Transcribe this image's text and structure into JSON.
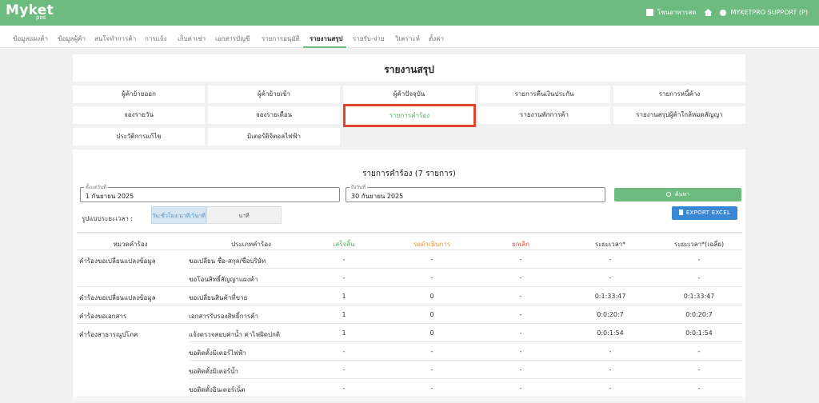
{
  "app": {
    "logo": "Myket",
    "logo_sub": "pos",
    "store_label": "โชนอาหารสด",
    "user_label": "MYKETPRO SUPPORT (P)"
  },
  "nav": {
    "tabs": [
      "ข้อมูลแผงค้า",
      "ข้อมูลผู้ค้า",
      "สนใจทำการค้า",
      "การแจ้ง",
      "เก็บค่าเช่า",
      "เอกสารบัญชี",
      "รายการอนุมัติ",
      "รายงานสรุป",
      "รายรับ-จ่าย",
      "วิเคราะห์",
      "ตั้งค่า"
    ],
    "active_index": 7
  },
  "report": {
    "title": "รายงานสรุป",
    "buttons": [
      "ผู้ค้าย้ายออก",
      "ผู้ค้าย้ายเข้า",
      "ผู้ค้าปัจจุบัน",
      "รายการคืนเงินประกัน",
      "รายการหนี้ค้าง",
      "จองรายวัน",
      "จองรายเดือน",
      "รายการคำร้อง",
      "รายงานพักการค้า",
      "รายงานสรุปผู้ค้าใกล้หมดสัญญา",
      "ประวัติการแก้ไข",
      "มิเตอร์ดิจิตอลไฟฟ้า"
    ],
    "selected_index": 7
  },
  "requests": {
    "title": "รายการคำร้อง (7 รายการ)",
    "start_date_label": "ตั้งแต่วันที่",
    "start_date": "1 กันยายน 2025",
    "end_date_label": "ถึงวันที่",
    "end_date": "30 กันยายน 2025",
    "search_label": "ค้นหา",
    "time_format_label": "รูปแบบระยะเวลา :",
    "time_format_options": [
      "วัน:ชั่วโมง:นาที:วินาที",
      "นาที"
    ],
    "time_format_selected": 0,
    "export_label": "EXPORT EXCEL"
  },
  "table": {
    "columns": [
      "หมวดคำร้อง",
      "ประเภทคำร้อง",
      "เสร็จสิ้น",
      "รอดำเนินการ",
      "ยกเลิก",
      "ระยะเวลา*",
      "ระยะเวลา*(เฉลี่ย)"
    ],
    "rows": [
      {
        "category": "คำร้องขอเปลี่ยนแปลงข้อมูล",
        "type": "ขอเปลี่ยน ชื่อ-สกุล/ชื่อบริษัท",
        "done": "-",
        "pending": "-",
        "cancel": "-",
        "duration": "-",
        "avg": "-"
      },
      {
        "category": "",
        "type": "ขอโอนสิทธิ์สัญญาแผงค้า",
        "done": "-",
        "pending": "-",
        "cancel": "-",
        "duration": "-",
        "avg": "-"
      },
      {
        "category": "คำร้องขอเปลี่ยนแปลงข้อมูล",
        "type": "ขอเปลี่ยนสินค้าที่ขาย",
        "done": "1",
        "pending": "0",
        "cancel": "-",
        "duration": "0:1:33:47",
        "avg": "0:1:33:47"
      },
      {
        "category": "คำร้องขอเอกสาร",
        "type": "เอกสารรับรองสิทธิ์การค้า",
        "done": "1",
        "pending": "0",
        "cancel": "-",
        "duration": "0:0:20:7",
        "avg": "0:0:20:7"
      },
      {
        "category": "คำร้องสาธารณูปโภค",
        "type": "แจ้งตรวจสอบค่าน้ำ ค่าไฟผิดปกติ",
        "done": "1",
        "pending": "0",
        "cancel": "-",
        "duration": "0:0:1:54",
        "avg": "0:0:1:54"
      },
      {
        "category": "",
        "type": "ขอติดตั้งมิเตอร์ไฟฟ้า",
        "done": "-",
        "pending": "-",
        "cancel": "-",
        "duration": "-",
        "avg": "-"
      },
      {
        "category": "",
        "type": "ขอติดตั้งมิเตอร์น้ำ",
        "done": "-",
        "pending": "-",
        "cancel": "-",
        "duration": "-",
        "avg": "-"
      },
      {
        "category": "",
        "type": "ขอติดตั้งอินเตอร์เน็ต",
        "done": "-",
        "pending": "-",
        "cancel": "-",
        "duration": "-",
        "avg": "-"
      }
    ]
  }
}
